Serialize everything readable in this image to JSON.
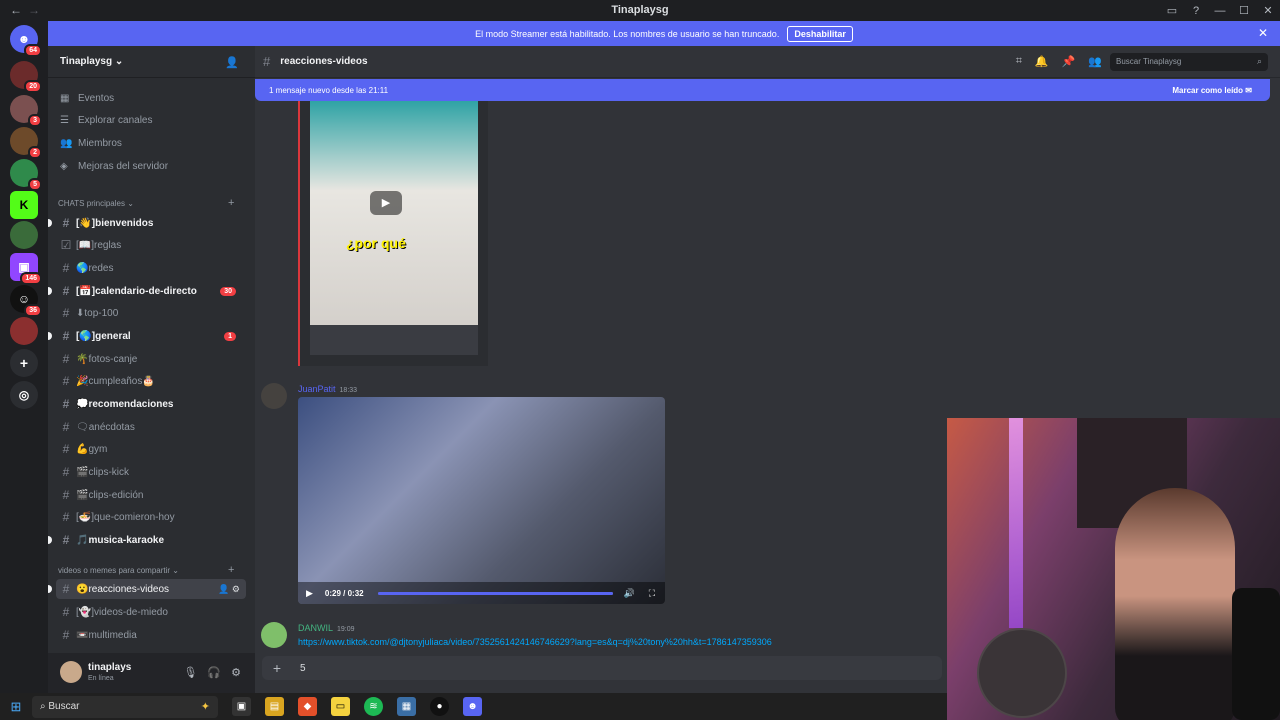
{
  "window": {
    "title": "Tinaplaysg"
  },
  "streamer_banner": {
    "text": "El modo Streamer está habilitado. Los nombres de usuario se han truncado.",
    "button": "Deshabilitar"
  },
  "guilds": [
    {
      "name": "home",
      "badge": "64"
    },
    {
      "name": "server-1",
      "badge": "20"
    },
    {
      "name": "server-2",
      "badge": "3"
    },
    {
      "name": "server-3",
      "badge": "2"
    },
    {
      "name": "server-4",
      "badge": "5"
    },
    {
      "name": "kick",
      "badge": ""
    },
    {
      "name": "server-6",
      "badge": ""
    },
    {
      "name": "twitch",
      "badge": "146"
    },
    {
      "name": "tinaplays",
      "badge": "36"
    },
    {
      "name": "server-9",
      "badge": ""
    }
  ],
  "server": {
    "name": "Tinaplaysg",
    "nav": [
      "Eventos",
      "Explorar canales",
      "Miembros",
      "Mejoras del servidor"
    ],
    "category1": "CHATS principales",
    "category2": "videos o memes para compartir",
    "channels": [
      {
        "label": "[👋]bienvenidos",
        "bold": true,
        "badge": ""
      },
      {
        "label": "[📖]reglas",
        "bold": false,
        "badge": ""
      },
      {
        "label": "🌎redes",
        "bold": false,
        "badge": ""
      },
      {
        "label": "[📅]calendario-de-directo",
        "bold": true,
        "badge": "30"
      },
      {
        "label": "⬇top-100",
        "bold": false,
        "badge": ""
      },
      {
        "label": "[🌎]general",
        "bold": true,
        "badge": "1"
      },
      {
        "label": "🌴fotos-canje",
        "bold": false,
        "badge": ""
      },
      {
        "label": "🎉cumpleaños🎂",
        "bold": false,
        "badge": ""
      },
      {
        "label": "💭recomendaciones",
        "bold": true,
        "badge": ""
      },
      {
        "label": "🗨anécdotas",
        "bold": false,
        "badge": ""
      },
      {
        "label": "💪gym",
        "bold": false,
        "badge": ""
      },
      {
        "label": "🎬clips-kick",
        "bold": false,
        "badge": ""
      },
      {
        "label": "🎬clips-edición",
        "bold": false,
        "badge": ""
      },
      {
        "label": "[🍜]que-comieron-hoy",
        "bold": false,
        "badge": ""
      },
      {
        "label": "🎵musica-karaoke",
        "bold": true,
        "badge": ""
      },
      {
        "label": "😮reacciones-videos",
        "bold": false,
        "badge": "",
        "active": true
      },
      {
        "label": "[👻]videos-de-miedo",
        "bold": false,
        "badge": ""
      },
      {
        "label": "📼multimedia",
        "bold": false,
        "badge": ""
      }
    ]
  },
  "user": {
    "name": "tinaplays",
    "status": "En línea"
  },
  "channel": {
    "name": "reacciones-videos",
    "search_placeholder": "Buscar Tinaplaysg",
    "new_messages": "1 mensaje nuevo desde las 21:11",
    "mark_read": "Marcar como leído"
  },
  "messages": [
    {
      "video_caption": "¿por qué"
    },
    {
      "author": "JuanPatit",
      "time": "18:33",
      "video_time": "0:29 / 0:32",
      "progress": 1.0
    },
    {
      "author": "DANWIL",
      "time": "19:09",
      "link": "https://www.tiktok.com/@djtonyjuliaca/video/7352561424146746629?lang=es&q=dj%20tony%20hh&t=1786147359306"
    }
  ],
  "composer": {
    "text": "5"
  },
  "taskbar": {
    "search": "Buscar"
  }
}
